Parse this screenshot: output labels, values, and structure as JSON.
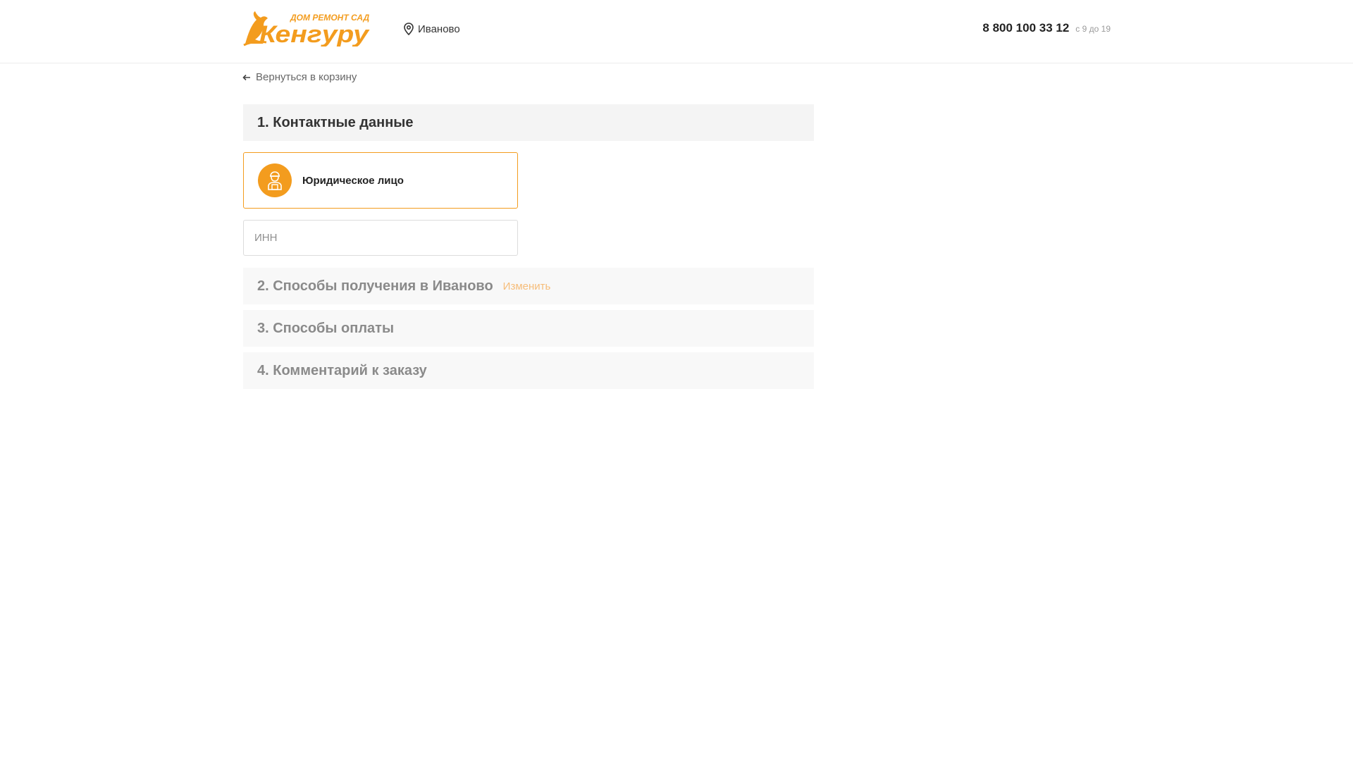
{
  "header": {
    "logo": {
      "tagline": "ДОМ РЕМОНТ САД",
      "brand": "Кенгуру"
    },
    "city": "Иваново",
    "phone": "8 800 100 33 12",
    "hours": "с 9 до 19"
  },
  "back_link": "Вернуться в корзину",
  "steps": [
    {
      "title": "1. Контактные данные"
    },
    {
      "title": "2. Способы получения в Иваново",
      "action": "Изменить"
    },
    {
      "title": "3. Способы оплаты"
    },
    {
      "title": "4. Комментарий к заказу"
    }
  ],
  "customer_type": {
    "label": "Юридическое лицо",
    "icon": "worker-icon"
  },
  "inn": {
    "placeholder": "ИНН",
    "value": ""
  },
  "colors": {
    "accent": "#f39c1e",
    "link_muted": "#f6bd7a"
  }
}
